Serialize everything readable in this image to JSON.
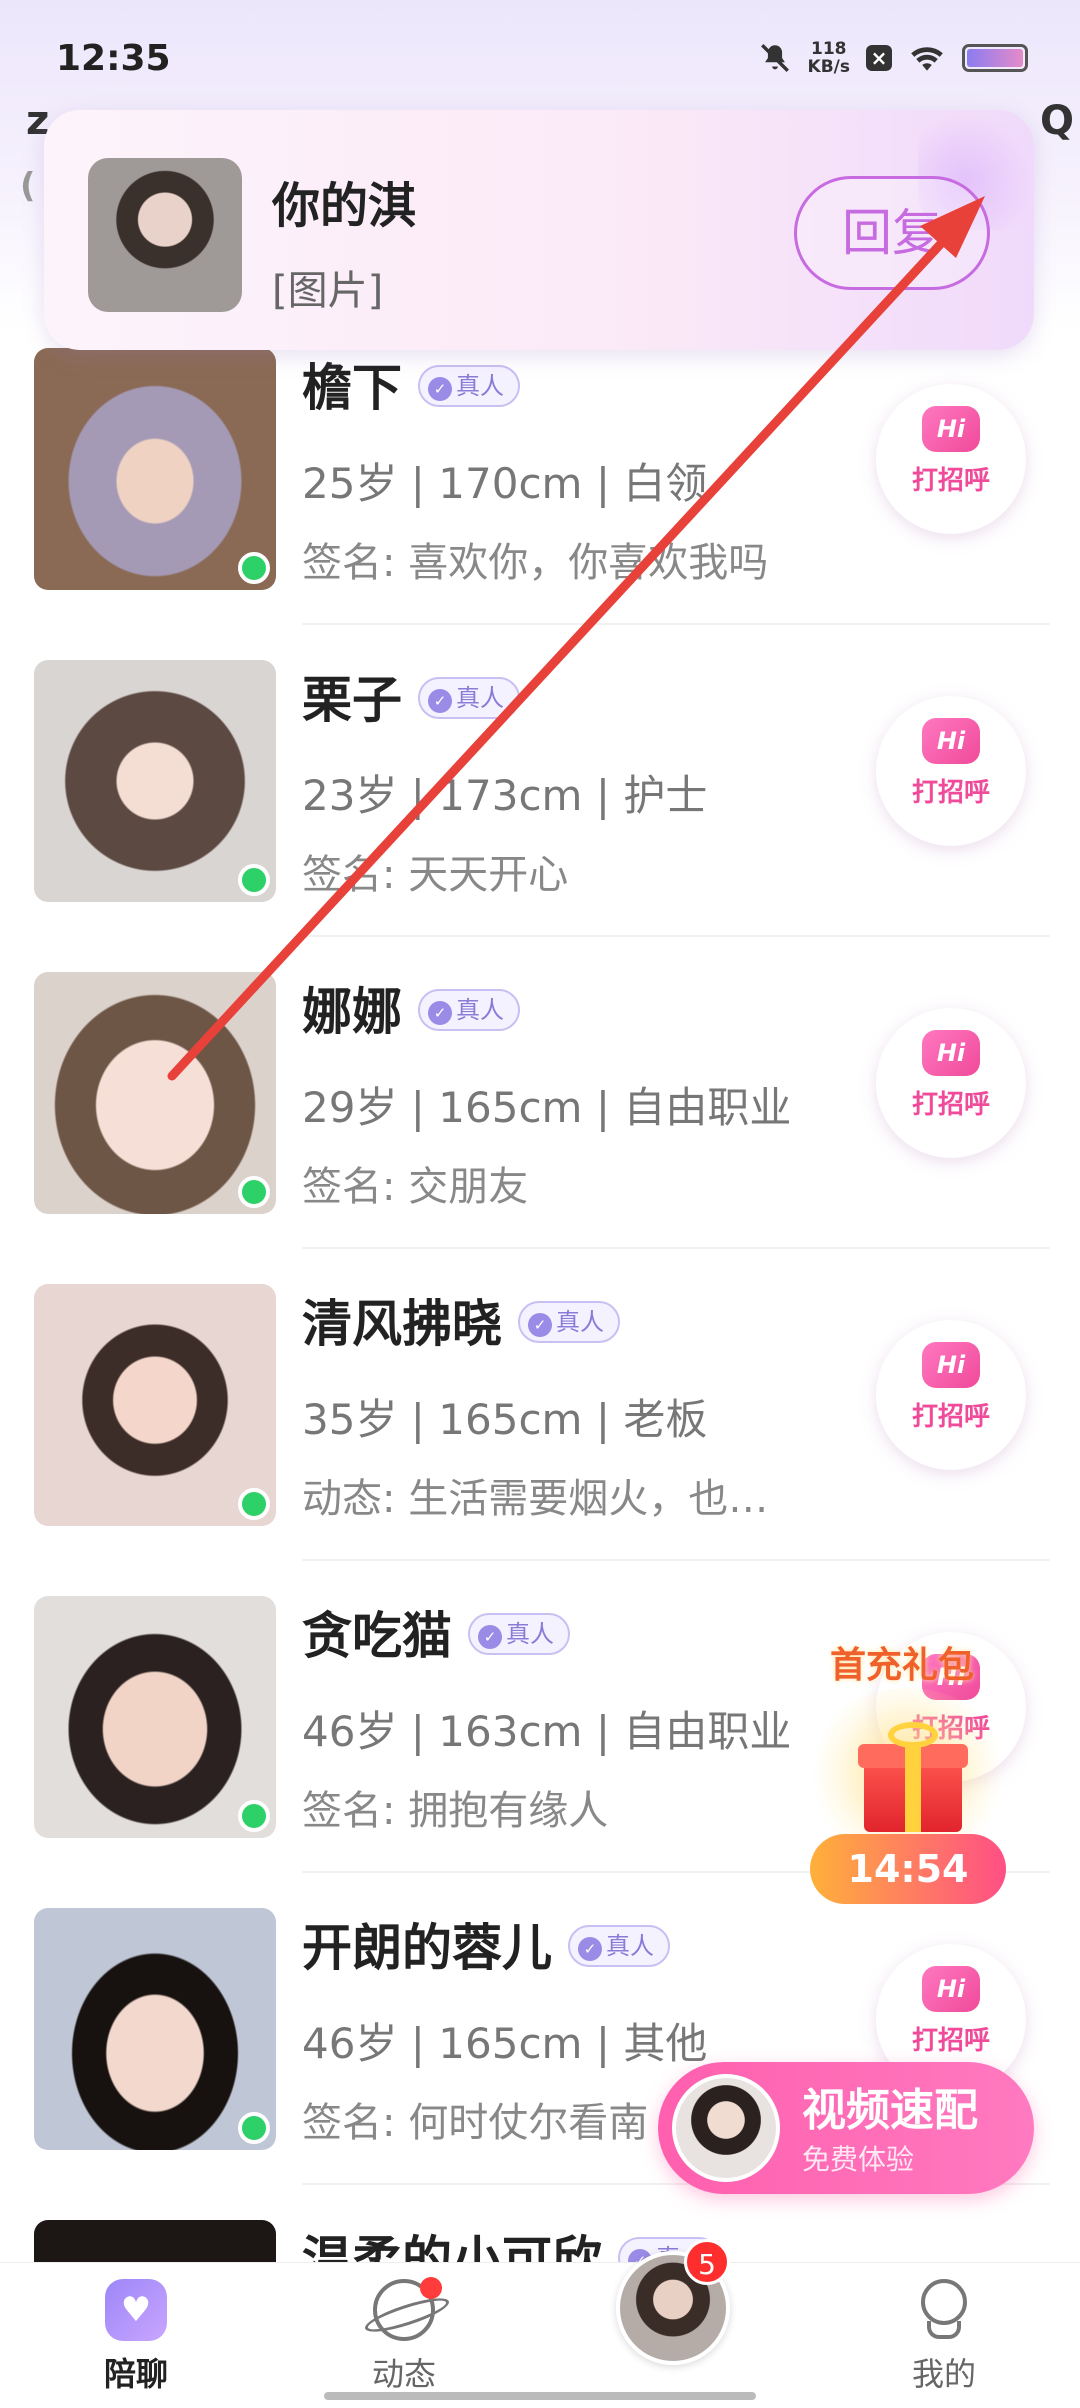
{
  "status_bar": {
    "time": "12:35",
    "net_speed_value": "118",
    "net_speed_unit": "KB/s",
    "icons": [
      "mute-icon",
      "wifi-icon",
      "x-app-icon",
      "battery-icon"
    ]
  },
  "notification": {
    "sender": "你的淇",
    "message": "[图片]",
    "reply_label": "回复"
  },
  "users": [
    {
      "name": "檐下",
      "badge": "真人",
      "info": "25岁 | 170cm | 白领",
      "line2": "签名: 喜欢你，你喜欢我吗",
      "online": true,
      "hi": "打招呼"
    },
    {
      "name": "栗子",
      "badge": "真人",
      "info": "23岁 | 173cm | 护士",
      "line2": "签名: 天天开心",
      "online": true,
      "hi": "打招呼"
    },
    {
      "name": "娜娜",
      "badge": "真人",
      "info": "29岁 | 165cm | 自由职业",
      "line2": "签名: 交朋友",
      "online": true,
      "hi": "打招呼"
    },
    {
      "name": "清风拂晓",
      "badge": "真人",
      "info": "35岁 | 165cm | 老板",
      "line2": "动态: 生活需要烟火，也…",
      "online": true,
      "hi": "打招呼"
    },
    {
      "name": "贪吃猫",
      "badge": "真人",
      "info": "46岁 | 163cm | 自由职业",
      "line2": "签名: 拥抱有缘人",
      "online": true,
      "hi": "打招呼"
    },
    {
      "name": "开朗的蓉儿",
      "badge": "真人",
      "info": "46岁 | 165cm | 其他",
      "line2": "签名: 何时仗尔看南",
      "online": true,
      "hi": "打招呼"
    },
    {
      "name": "温柔的小可欣",
      "badge": "真人",
      "info": "",
      "line2": "",
      "online": false,
      "hi": ""
    }
  ],
  "hi_bubble_text": "Hi",
  "gift": {
    "title": "首充礼包",
    "timer": "14:54"
  },
  "video_match": {
    "title": "视频速配",
    "subtitle": "免费体验"
  },
  "bottom_nav": {
    "items": [
      {
        "label": "陪聊",
        "icon": "heart-chat-icon",
        "active": true
      },
      {
        "label": "动态",
        "icon": "planet-icon",
        "active": false
      },
      {
        "label": "",
        "icon": "avatar",
        "badge_count": "5"
      },
      {
        "label": "我的",
        "icon": "person-icon",
        "active": false
      }
    ]
  },
  "colors": {
    "accent_pink": "#f04a9a",
    "online_green": "#2ed068",
    "badge_purple": "#8b7bd8",
    "arrow_red": "#e8413a"
  }
}
